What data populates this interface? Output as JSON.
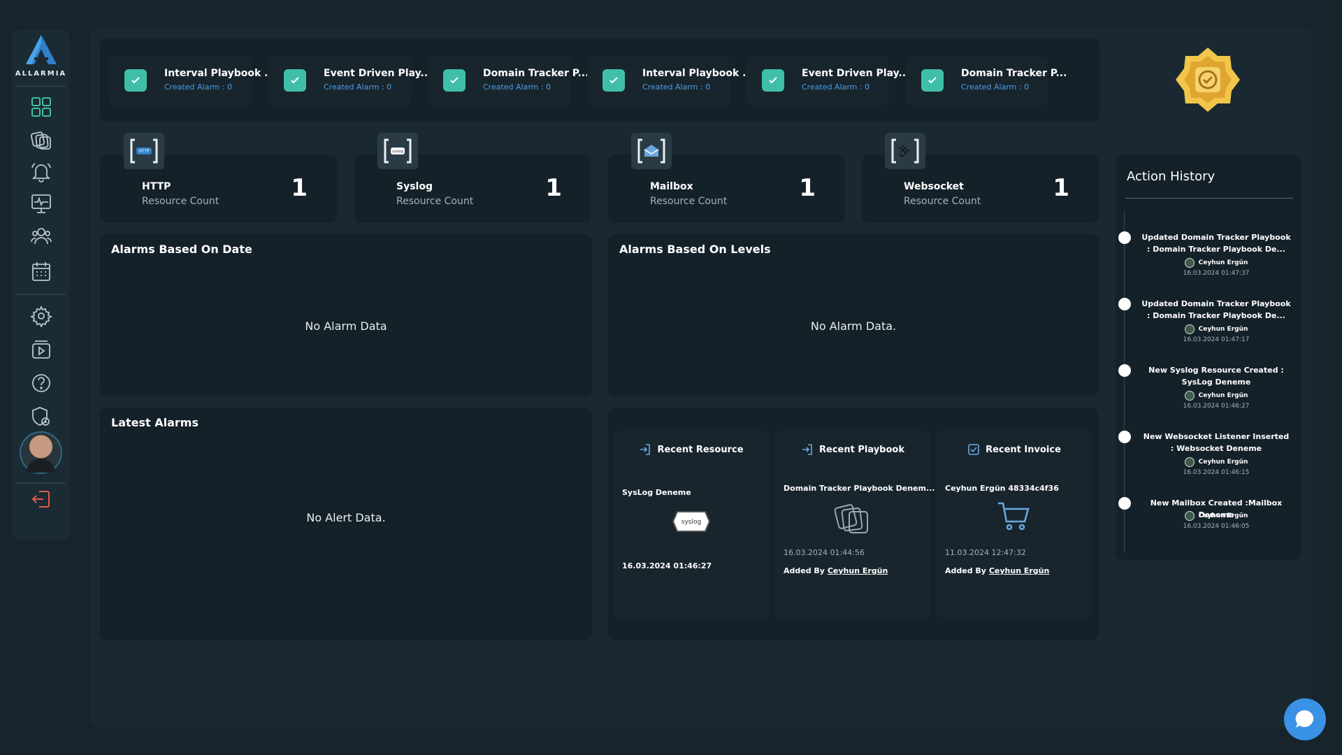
{
  "brand": {
    "name": "ALLARMIA"
  },
  "colors": {
    "accent": "#3fbfa8",
    "link": "#4e9de6",
    "chat": "#3a92e6",
    "logout": "#e7584e"
  },
  "sidebar": {
    "items": [
      {
        "icon": "dashboard-grid-icon"
      },
      {
        "icon": "playbooks-icon"
      },
      {
        "icon": "alarm-bell-icon"
      },
      {
        "icon": "monitor-icon"
      },
      {
        "icon": "users-icon"
      },
      {
        "icon": "calendar-icon"
      },
      {
        "icon": "settings-gear-icon"
      },
      {
        "icon": "video-tutorials-icon"
      },
      {
        "icon": "help-icon"
      },
      {
        "icon": "security-shield-icon"
      },
      {
        "icon": "logout-icon"
      }
    ]
  },
  "playbooks": [
    {
      "title": "Interval Playbook ...",
      "sub": "Created Alarm : 0"
    },
    {
      "title": "Event Driven Play...",
      "sub": "Created Alarm : 0"
    },
    {
      "title": "Domain Tracker P...",
      "sub": "Created Alarm : 0"
    },
    {
      "title": "Interval Playbook ...",
      "sub": "Created Alarm : 0"
    },
    {
      "title": "Event Driven Play...",
      "sub": "Created Alarm : 0"
    },
    {
      "title": "Domain Tracker P...",
      "sub": "Created Alarm : 0"
    }
  ],
  "resources": [
    {
      "name": "HTTP",
      "sub": "Resource Count",
      "count": "1",
      "icon_text": "HTTP"
    },
    {
      "name": "Syslog",
      "sub": "Resource Count",
      "count": "1",
      "icon_text": "syslog"
    },
    {
      "name": "Mailbox",
      "sub": "Resource Count",
      "count": "1"
    },
    {
      "name": "Websocket",
      "sub": "Resource Count",
      "count": "1"
    }
  ],
  "alarms_date": {
    "title": "Alarms Based On Date",
    "empty": "No Alarm Data"
  },
  "alarms_levels": {
    "title": "Alarms Based On Levels",
    "empty": "No Alarm Data."
  },
  "latest_alarms": {
    "title": "Latest Alarms",
    "empty": "No Alert Data."
  },
  "recent": {
    "resource": {
      "title": "Recent Resource",
      "name": "SysLog Deneme",
      "logo_text": "syslog",
      "date": "16.03.2024 01:46:27"
    },
    "playbook": {
      "title": "Recent Playbook",
      "name": "Domain Tracker Playbook Denem...",
      "date": "16.03.2024 01:44:56",
      "added_by_label": "Added By",
      "added_by": "Ceyhun Ergün"
    },
    "invoice": {
      "title": "Recent Invoice",
      "name": "Ceyhun Ergün 48334c4f36",
      "date": "11.03.2024 12:47:32",
      "added_by_label": "Added By",
      "added_by": "Ceyhun Ergün"
    }
  },
  "action_history": {
    "title": "Action History",
    "items": [
      {
        "text": "Updated Domain Tracker Playbook : Domain Tracker Playbook De...",
        "user": "Ceyhun Ergün",
        "date": "16.03.2024 01:47:37"
      },
      {
        "text": "Updated Domain Tracker Playbook : Domain Tracker Playbook De...",
        "user": "Ceyhun Ergün",
        "date": "16.03.2024 01:47:17"
      },
      {
        "text": "New Syslog Resource Created : SysLog Deneme",
        "user": "Ceyhun Ergün",
        "date": "16.03.2024 01:46:27"
      },
      {
        "text": "New Websocket Listener Inserted : Websocket Deneme",
        "user": "Ceyhun Ergün",
        "date": "16.03.2024 01:46:15"
      },
      {
        "text": "New Mailbox Created :Mailbox Deneme",
        "user": "Ceyhun Ergün",
        "date": "16.03.2024 01:46:05"
      }
    ]
  }
}
